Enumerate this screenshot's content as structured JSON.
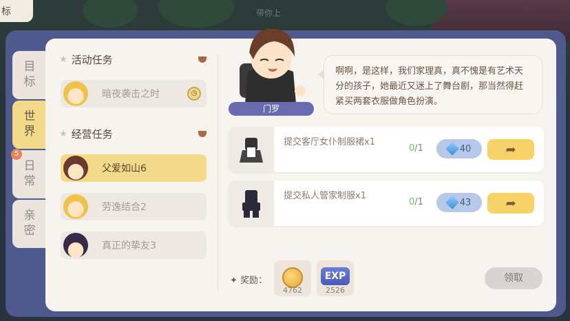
{
  "top_corner_tab": "标",
  "scene_label": "带你上",
  "side_tabs": [
    {
      "label": "目标",
      "active": false,
      "badge": ""
    },
    {
      "label": "世界",
      "active": true,
      "badge": ""
    },
    {
      "label": "日常",
      "active": false,
      "badge": "5"
    },
    {
      "label": "亲密",
      "active": false,
      "badge": ""
    }
  ],
  "sections": {
    "activity": {
      "title": "活动任务",
      "tasks": [
        {
          "label": "暗夜袭击之时",
          "has_clock": true
        }
      ]
    },
    "business": {
      "title": "经营任务",
      "tasks": [
        {
          "label": "父爱如山6",
          "active": true
        },
        {
          "label": "劳逸结合2",
          "active": false
        },
        {
          "label": "真正的挚友3",
          "active": false
        }
      ]
    }
  },
  "npc": {
    "name": "门罗",
    "dialog": "啊啊，是这样，我们家理真，真不愧是有艺术天分的孩子，她最近又迷上了舞台剧，那当然得赶紧买两套衣服做角色扮演。"
  },
  "items": [
    {
      "name": "提交客厅女仆制服裙x1",
      "progress": "0",
      "total": "/1",
      "cost": "40"
    },
    {
      "name": "提交私人管家制服x1",
      "progress": "0",
      "total": "/1",
      "cost": "43"
    }
  ],
  "reward": {
    "label": "奖励：",
    "coin_amount": "4762",
    "exp_label": "EXP",
    "exp_amount": "2526"
  },
  "claim_button": "领取",
  "icons": {
    "arrow": "share-arrow-icon",
    "gem": "gem-icon",
    "clock": "clock-icon"
  },
  "colors": {
    "active_tab": "#f3d98a",
    "frame": "#4e5a8c",
    "go_button": "#f6d269"
  }
}
